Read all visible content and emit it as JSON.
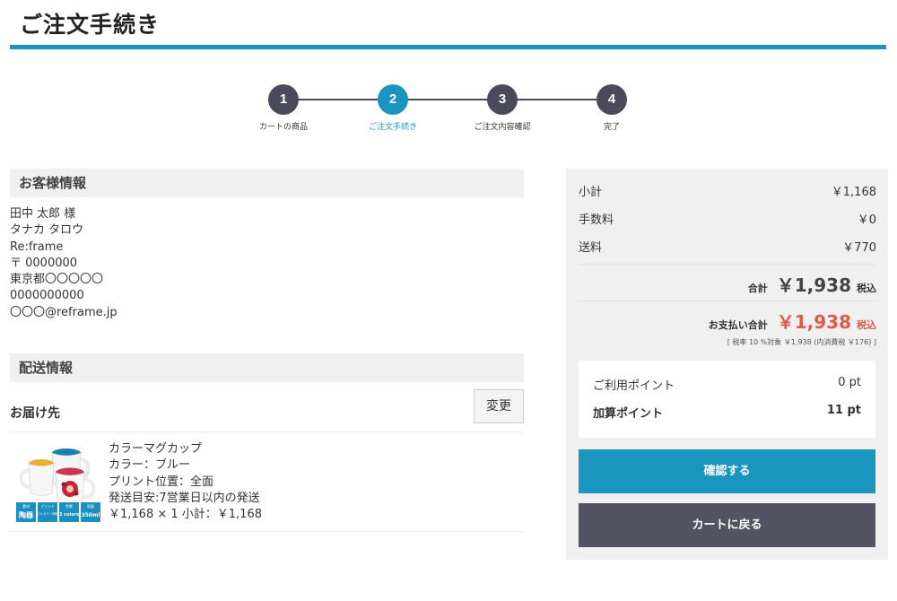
{
  "page": {
    "title": "ご注文手続き"
  },
  "steps": [
    {
      "num": "1",
      "label": "カートの商品",
      "active": false
    },
    {
      "num": "2",
      "label": "ご注文手続き",
      "active": true
    },
    {
      "num": "3",
      "label": "ご注文内容確認",
      "active": false
    },
    {
      "num": "4",
      "label": "完了",
      "active": false
    }
  ],
  "customer": {
    "heading": "お客様情報",
    "lines": [
      "田中 太郎 様",
      "タナカ タロウ",
      "Re:frame",
      "〒 0000000",
      "東京都〇〇〇〇〇",
      "0000000000",
      "〇〇〇@reframe.jp"
    ]
  },
  "delivery": {
    "heading": "配送情報",
    "destination_label": "お届け先",
    "change_label": "変更",
    "product": {
      "lines": [
        "カラーマグカップ",
        "カラー：ブルー",
        "プリント位置：全面",
        "発送目安:7営業日以内の発送",
        "￥1,168 × 1  小計：￥1,168"
      ],
      "badges": [
        {
          "top": "素材",
          "main": "陶器"
        },
        {
          "top": "プリント",
          "main": "フルカラー印刷"
        },
        {
          "top": "色数",
          "main": "3 colors"
        },
        {
          "top": "容量",
          "main": "350ml"
        }
      ]
    }
  },
  "summary": {
    "subtotal_label": "小計",
    "subtotal": "￥1,168",
    "fee_label": "手数料",
    "fee": "￥0",
    "shipping_label": "送料",
    "shipping": "￥770",
    "total_label": "合計",
    "total": "￥1,938",
    "total_tax": "税込",
    "pay_label": "お支払い合計",
    "pay": "￥1,938",
    "pay_tax": "税込",
    "tax_note": "[ 税率 10 %対象  ￥1,938 (内消費税 ￥176) ]",
    "points_used_label": "ご利用ポイント",
    "points_used": "0 pt",
    "points_added_label": "加算ポイント",
    "points_added": "11 pt",
    "confirm_label": "確認する",
    "back_label": "カートに戻る"
  },
  "colors": {
    "accent": "#1a95c0",
    "dark": "#4a4a5a",
    "price_red": "#e05a4a"
  }
}
